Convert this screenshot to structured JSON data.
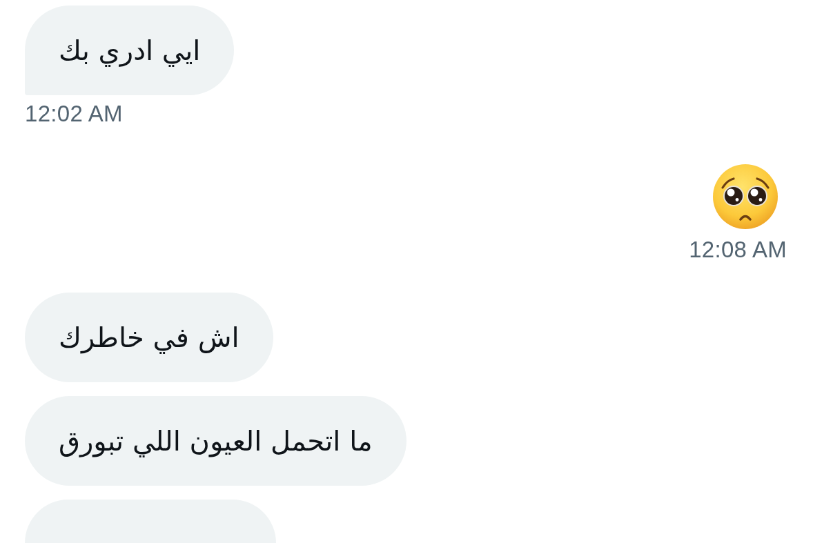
{
  "conversation": {
    "messages": [
      {
        "outgoing": false,
        "kind": "text",
        "text": "ايي ادري بك",
        "time": "12:02 AM"
      },
      {
        "outgoing": true,
        "kind": "emoji",
        "time": "12:08 AM"
      },
      {
        "outgoing": false,
        "kind": "text",
        "text": "اش في خاطرك"
      },
      {
        "outgoing": false,
        "kind": "text",
        "text": "ما اتحمل العيون اللي تبورق"
      },
      {
        "outgoing": false,
        "kind": "partial"
      }
    ]
  }
}
